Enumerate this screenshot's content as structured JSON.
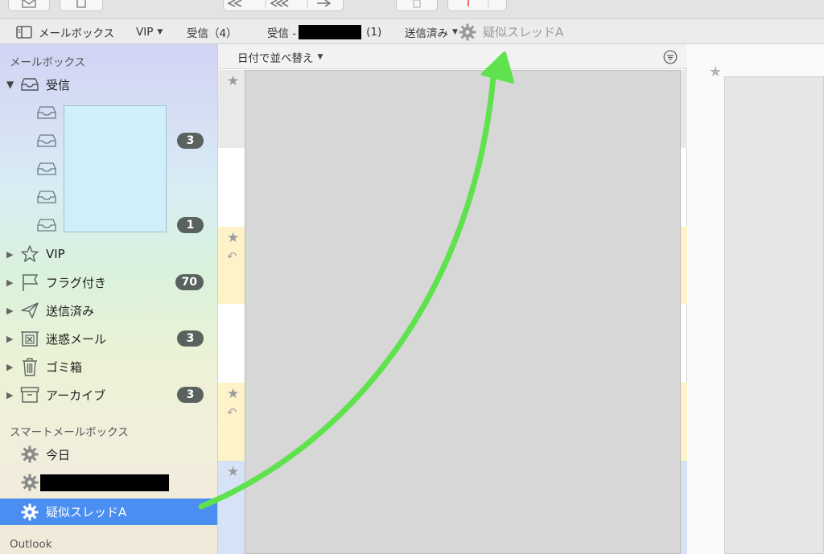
{
  "favorites": {
    "mailboxes_label": "メールボックス",
    "vip_label": "VIP",
    "inbox_label": "受信（4）",
    "inbox2_prefix": "受信 -",
    "inbox2_count": "(1)",
    "sent_label": "送信済み",
    "smart_label": "疑似スレッドA"
  },
  "sidebar": {
    "section_mailboxes": "メールボックス",
    "inbox": {
      "label": "受信"
    },
    "sub_badges": [
      "3",
      "1"
    ],
    "items": [
      {
        "label": "VIP",
        "icon": "star-icon"
      },
      {
        "label": "フラグ付き",
        "icon": "flag-icon",
        "badge": "70"
      },
      {
        "label": "送信済み",
        "icon": "paper-plane-icon"
      },
      {
        "label": "迷惑メール",
        "icon": "junk-icon",
        "badge": "3"
      },
      {
        "label": "ゴミ箱",
        "icon": "trash-icon"
      },
      {
        "label": "アーカイブ",
        "icon": "archive-icon",
        "badge": "3"
      }
    ],
    "section_smart": "スマートメールボックス",
    "smart": [
      {
        "label": "今日"
      },
      {
        "label": "疑似スレッドA",
        "selected": true
      }
    ],
    "section_outlook": "Outlook"
  },
  "list": {
    "sort_label": "日付で並べ替え"
  },
  "colors": {
    "accent": "#4a8ef1",
    "badge": "#59625e",
    "arrow": "#5fe24e",
    "yellow_band": "#fdf2c8",
    "blue_band": "#d6e2f5"
  }
}
